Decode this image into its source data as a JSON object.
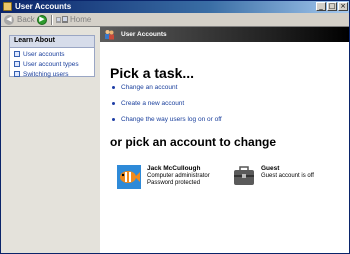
{
  "window": {
    "title": "User Accounts",
    "controls": [
      "_",
      "□",
      "×"
    ]
  },
  "toolbar": {
    "back_label": "Back",
    "home_label": "Home"
  },
  "sidebar": {
    "heading": "Learn About",
    "links": [
      "User accounts",
      "User account types",
      "Switching users"
    ]
  },
  "banner": {
    "title": "User Accounts"
  },
  "main": {
    "pick_task_heading": "Pick a task...",
    "tasks": [
      "Change an account",
      "Create a new account",
      "Change the way users log on or off"
    ],
    "pick_account_heading": "or pick an account to change",
    "accounts": [
      {
        "name": "Jack McCullough",
        "lines": [
          "Computer administrator",
          "Password protected"
        ],
        "icon": "fish-icon"
      },
      {
        "name": "Guest",
        "lines": [
          "Guest account is off"
        ],
        "icon": "suitcase-icon"
      }
    ]
  },
  "colors": {
    "link": "#1a3f9c",
    "banner": "#202020",
    "titlebar": "#0a246a",
    "sidebar": "#e4e2db"
  }
}
